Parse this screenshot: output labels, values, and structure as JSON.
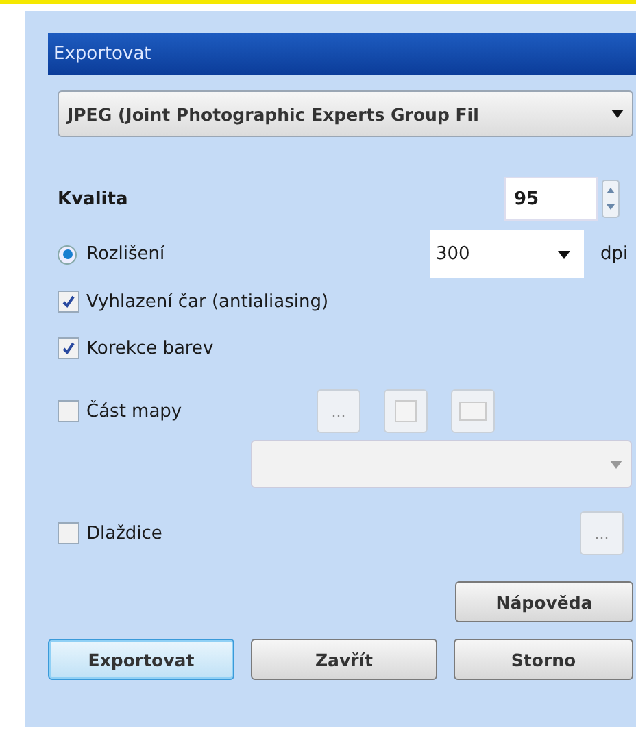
{
  "window": {
    "title": "Exportovat"
  },
  "format": {
    "value": "JPEG (Joint Photographic Experts Group Fil"
  },
  "quality": {
    "label": "Kvalita",
    "value": "95"
  },
  "resolution": {
    "label": "Rozlišení",
    "selected": true,
    "value": "300",
    "unit": "dpi"
  },
  "options": [
    {
      "label": "Vyhlazení čar (antialiasing)",
      "checked": true
    },
    {
      "label": "Korekce barev",
      "checked": true
    }
  ],
  "map_part": {
    "label": "Část mapy",
    "checked": false,
    "button": "...",
    "button_disabled": true
  },
  "tiles": {
    "label": "Dlaždice",
    "checked": false,
    "button": "...",
    "button_disabled": true
  },
  "help_button": "Nápověda",
  "buttons": [
    {
      "label": "Exportovat",
      "default": true
    },
    {
      "label": "Zavřít",
      "default": false
    },
    {
      "label": "Storno",
      "default": false
    }
  ]
}
